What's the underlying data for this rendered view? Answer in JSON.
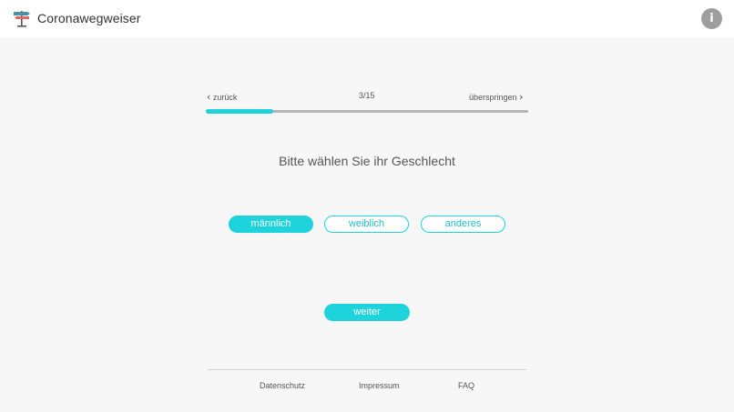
{
  "header": {
    "title": "Coronawegweiser",
    "logo_icon": "signpost-icon",
    "info_label": "i"
  },
  "navigation": {
    "back_label": "zurück",
    "step_counter": "3/15",
    "skip_label": "überspringen"
  },
  "progress": {
    "current_step": 3,
    "total_steps": 15,
    "fraction": 0.21
  },
  "question": {
    "text": "Bitte wählen Sie ihr Geschlecht",
    "options": [
      {
        "label": "männlich",
        "selected": true
      },
      {
        "label": "weiblich",
        "selected": false
      },
      {
        "label": "anderes",
        "selected": false
      }
    ]
  },
  "actions": {
    "next_label": "weiter"
  },
  "footer": {
    "links": [
      "Datenschutz",
      "Impressum",
      "FAQ"
    ]
  },
  "colors": {
    "accent": "#1fd3dd",
    "background": "#f7f7f7",
    "info_button": "#9e9e9e"
  }
}
